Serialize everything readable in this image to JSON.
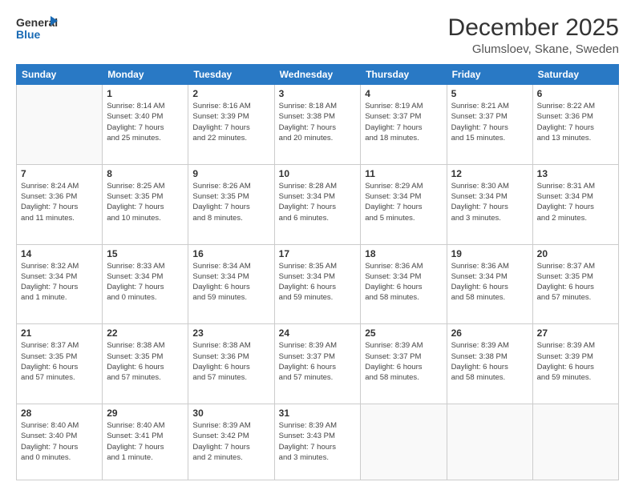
{
  "logo": {
    "line1": "General",
    "line2": "Blue"
  },
  "header": {
    "month": "December 2025",
    "location": "Glumsloev, Skane, Sweden"
  },
  "columns": [
    "Sunday",
    "Monday",
    "Tuesday",
    "Wednesday",
    "Thursday",
    "Friday",
    "Saturday"
  ],
  "weeks": [
    [
      {
        "day": "",
        "text": ""
      },
      {
        "day": "1",
        "text": "Sunrise: 8:14 AM\nSunset: 3:40 PM\nDaylight: 7 hours\nand 25 minutes."
      },
      {
        "day": "2",
        "text": "Sunrise: 8:16 AM\nSunset: 3:39 PM\nDaylight: 7 hours\nand 22 minutes."
      },
      {
        "day": "3",
        "text": "Sunrise: 8:18 AM\nSunset: 3:38 PM\nDaylight: 7 hours\nand 20 minutes."
      },
      {
        "day": "4",
        "text": "Sunrise: 8:19 AM\nSunset: 3:37 PM\nDaylight: 7 hours\nand 18 minutes."
      },
      {
        "day": "5",
        "text": "Sunrise: 8:21 AM\nSunset: 3:37 PM\nDaylight: 7 hours\nand 15 minutes."
      },
      {
        "day": "6",
        "text": "Sunrise: 8:22 AM\nSunset: 3:36 PM\nDaylight: 7 hours\nand 13 minutes."
      }
    ],
    [
      {
        "day": "7",
        "text": "Sunrise: 8:24 AM\nSunset: 3:36 PM\nDaylight: 7 hours\nand 11 minutes."
      },
      {
        "day": "8",
        "text": "Sunrise: 8:25 AM\nSunset: 3:35 PM\nDaylight: 7 hours\nand 10 minutes."
      },
      {
        "day": "9",
        "text": "Sunrise: 8:26 AM\nSunset: 3:35 PM\nDaylight: 7 hours\nand 8 minutes."
      },
      {
        "day": "10",
        "text": "Sunrise: 8:28 AM\nSunset: 3:34 PM\nDaylight: 7 hours\nand 6 minutes."
      },
      {
        "day": "11",
        "text": "Sunrise: 8:29 AM\nSunset: 3:34 PM\nDaylight: 7 hours\nand 5 minutes."
      },
      {
        "day": "12",
        "text": "Sunrise: 8:30 AM\nSunset: 3:34 PM\nDaylight: 7 hours\nand 3 minutes."
      },
      {
        "day": "13",
        "text": "Sunrise: 8:31 AM\nSunset: 3:34 PM\nDaylight: 7 hours\nand 2 minutes."
      }
    ],
    [
      {
        "day": "14",
        "text": "Sunrise: 8:32 AM\nSunset: 3:34 PM\nDaylight: 7 hours\nand 1 minute."
      },
      {
        "day": "15",
        "text": "Sunrise: 8:33 AM\nSunset: 3:34 PM\nDaylight: 7 hours\nand 0 minutes."
      },
      {
        "day": "16",
        "text": "Sunrise: 8:34 AM\nSunset: 3:34 PM\nDaylight: 6 hours\nand 59 minutes."
      },
      {
        "day": "17",
        "text": "Sunrise: 8:35 AM\nSunset: 3:34 PM\nDaylight: 6 hours\nand 59 minutes."
      },
      {
        "day": "18",
        "text": "Sunrise: 8:36 AM\nSunset: 3:34 PM\nDaylight: 6 hours\nand 58 minutes."
      },
      {
        "day": "19",
        "text": "Sunrise: 8:36 AM\nSunset: 3:34 PM\nDaylight: 6 hours\nand 58 minutes."
      },
      {
        "day": "20",
        "text": "Sunrise: 8:37 AM\nSunset: 3:35 PM\nDaylight: 6 hours\nand 57 minutes."
      }
    ],
    [
      {
        "day": "21",
        "text": "Sunrise: 8:37 AM\nSunset: 3:35 PM\nDaylight: 6 hours\nand 57 minutes."
      },
      {
        "day": "22",
        "text": "Sunrise: 8:38 AM\nSunset: 3:35 PM\nDaylight: 6 hours\nand 57 minutes."
      },
      {
        "day": "23",
        "text": "Sunrise: 8:38 AM\nSunset: 3:36 PM\nDaylight: 6 hours\nand 57 minutes."
      },
      {
        "day": "24",
        "text": "Sunrise: 8:39 AM\nSunset: 3:37 PM\nDaylight: 6 hours\nand 57 minutes."
      },
      {
        "day": "25",
        "text": "Sunrise: 8:39 AM\nSunset: 3:37 PM\nDaylight: 6 hours\nand 58 minutes."
      },
      {
        "day": "26",
        "text": "Sunrise: 8:39 AM\nSunset: 3:38 PM\nDaylight: 6 hours\nand 58 minutes."
      },
      {
        "day": "27",
        "text": "Sunrise: 8:39 AM\nSunset: 3:39 PM\nDaylight: 6 hours\nand 59 minutes."
      }
    ],
    [
      {
        "day": "28",
        "text": "Sunrise: 8:40 AM\nSunset: 3:40 PM\nDaylight: 7 hours\nand 0 minutes."
      },
      {
        "day": "29",
        "text": "Sunrise: 8:40 AM\nSunset: 3:41 PM\nDaylight: 7 hours\nand 1 minute."
      },
      {
        "day": "30",
        "text": "Sunrise: 8:39 AM\nSunset: 3:42 PM\nDaylight: 7 hours\nand 2 minutes."
      },
      {
        "day": "31",
        "text": "Sunrise: 8:39 AM\nSunset: 3:43 PM\nDaylight: 7 hours\nand 3 minutes."
      },
      {
        "day": "",
        "text": ""
      },
      {
        "day": "",
        "text": ""
      },
      {
        "day": "",
        "text": ""
      }
    ]
  ]
}
